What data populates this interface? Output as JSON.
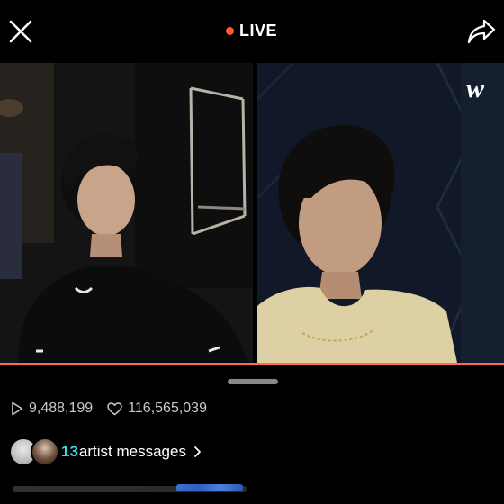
{
  "header": {
    "live_label": "LIVE",
    "live_color": "#ff5a2c",
    "close_icon": "close-icon",
    "share_icon": "share-icon"
  },
  "watermark": {
    "text": "w"
  },
  "stats": {
    "views": "9,488,199",
    "likes": "116,565,039",
    "views_icon": "play-icon",
    "likes_icon": "heart-icon"
  },
  "messages": {
    "count": "13",
    "label": "artist messages",
    "count_color": "#3fd7e8"
  },
  "accent": {
    "progress_color": "#ff6b4a"
  }
}
